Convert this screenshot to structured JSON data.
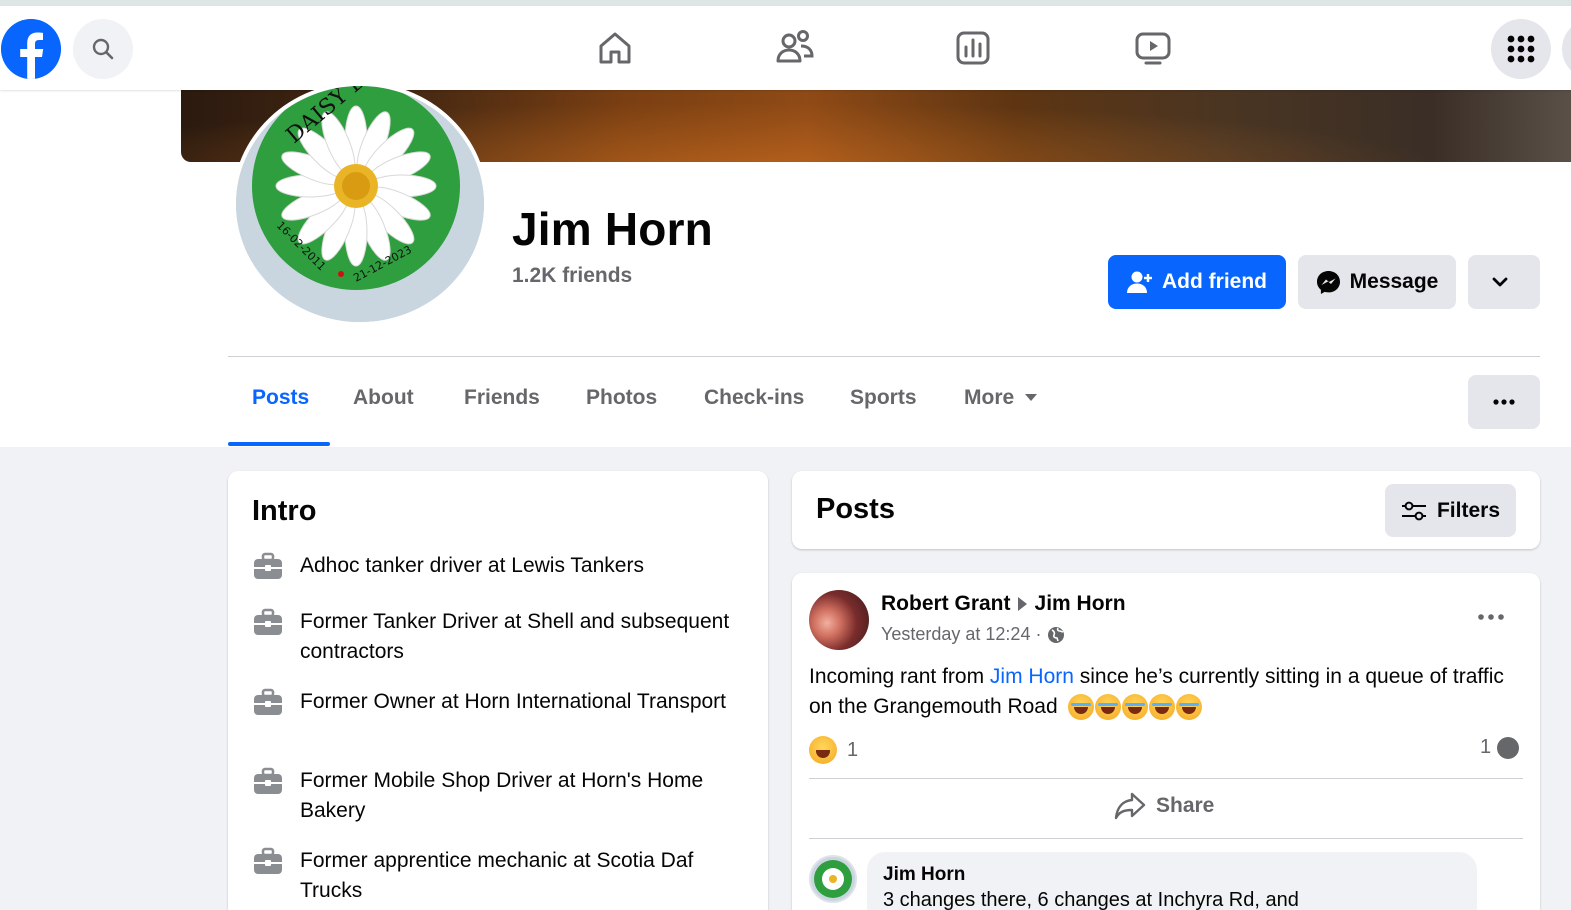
{
  "profile": {
    "name": "Jim Horn",
    "friends": "1.2K friends",
    "avatar_text_top": "DAISY BULL",
    "avatar_date_left": "16-02-2011",
    "avatar_date_right": "21-12-2023"
  },
  "actions": {
    "add_friend": "Add friend",
    "message": "Message"
  },
  "tabs": [
    {
      "label": "Posts",
      "active": true
    },
    {
      "label": "About"
    },
    {
      "label": "Friends"
    },
    {
      "label": "Photos"
    },
    {
      "label": "Check-ins"
    },
    {
      "label": "Sports"
    },
    {
      "label": "More"
    }
  ],
  "intro": {
    "title": "Intro",
    "items": [
      "Adhoc tanker driver at Lewis Tankers",
      "Former Tanker Driver at Shell and subsequent contractors",
      "Former Owner at Horn International Transport",
      "Former Mobile Shop Driver at Horn's Home Bakery",
      "Former apprentice mechanic at Scotia Daf Trucks"
    ]
  },
  "posts_section": {
    "title": "Posts",
    "filters": "Filters"
  },
  "post": {
    "author": "Robert Grant",
    "target": "Jim Horn",
    "time": "Yesterday at 12:24 ·",
    "text_before": "Incoming rant from ",
    "mention": "Jim Horn",
    "text_after": " since he’s currently  sitting in a queue of traffic on the Grangemouth Road",
    "reaction_count": "1",
    "comment_count": "1",
    "share": "Share"
  },
  "comment": {
    "author": "Jim Horn",
    "text": "3 changes there, 6 changes at Inchyra Rd, and"
  },
  "colors": {
    "brand": "#0866ff",
    "avatar_green": "#2e9e3e"
  },
  "icons": [
    "facebook-logo-icon",
    "search-icon",
    "home-icon",
    "friends-icon",
    "dashboard-icon",
    "video-icon",
    "menu-grid-icon",
    "add-friend-icon",
    "messenger-icon",
    "chevron-down-icon",
    "more-dots-icon",
    "briefcase-icon",
    "filters-icon",
    "globe-icon",
    "share-icon"
  ]
}
